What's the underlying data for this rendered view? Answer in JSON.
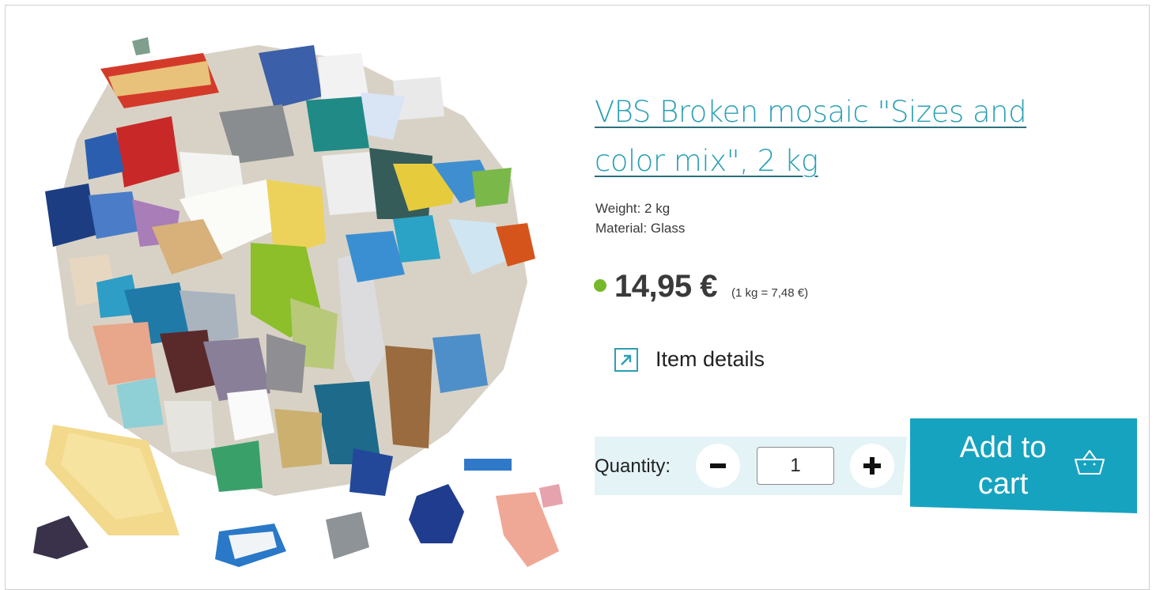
{
  "product": {
    "title": "VBS Broken mosaic \"Sizes and color mix\", 2 kg",
    "image_alt": "Broken glass mosaic pieces in mixed sizes and colors",
    "specs": {
      "weight": "Weight: 2 kg",
      "material": "Material: Glass"
    },
    "availability_color": "#76b82a",
    "price": "14,95 €",
    "unit_price": "(1 kg = 7,48 €)",
    "details_link": "Item details",
    "details_icon": "external-arrow-icon"
  },
  "cart": {
    "quantity_label": "Quantity:",
    "quantity_value": "1",
    "decrement_icon": "minus-icon",
    "increment_icon": "plus-icon",
    "add_to_cart_label": "Add to cart",
    "basket_icon": "basket-icon"
  },
  "colors": {
    "accent": "#16a3c0",
    "link": "#2aa0b4",
    "quantity_bar": "#e4f3f6",
    "text": "#3a3a3a"
  }
}
